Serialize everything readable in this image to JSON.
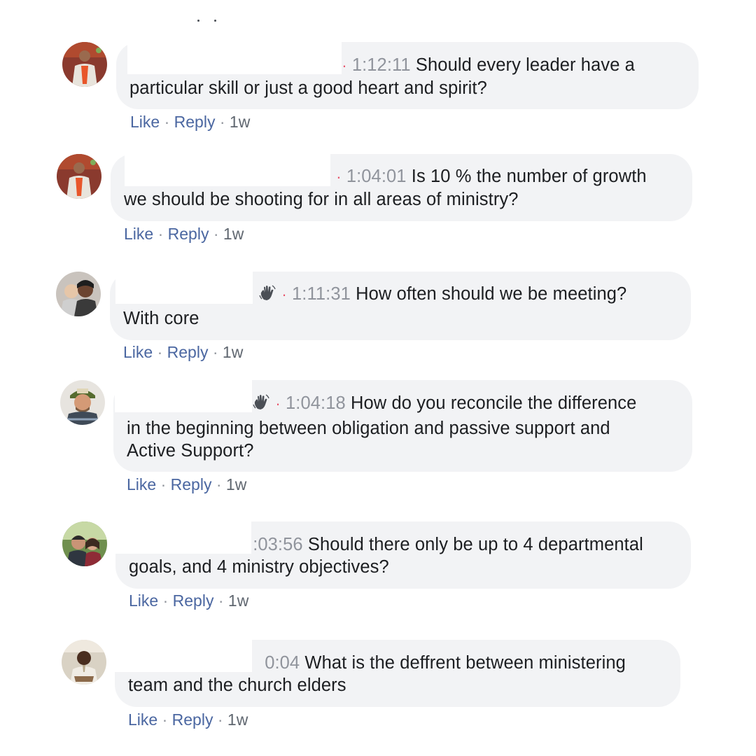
{
  "comments": [
    {
      "timestamp": "1:12:11",
      "lines": [
        "Should every leader have a",
        "particular skill or just a good heart and spirit?"
      ],
      "like_label": "Like",
      "reply_label": "Reply",
      "age": "1w",
      "has_wave": false,
      "avatar_colors": {
        "bg": "#8a3a2e",
        "shirt": "#e8e4dc",
        "accent": "#e8562a",
        "skin": "#9a6a4e"
      }
    },
    {
      "timestamp": "1:04:01",
      "lines": [
        "Is 10 % the number of growth",
        "we should be shooting for in all areas of ministry?"
      ],
      "like_label": "Like",
      "reply_label": "Reply",
      "age": "1w",
      "has_wave": false,
      "avatar_colors": {
        "bg": "#8a3a2e",
        "shirt": "#e8e4dc",
        "accent": "#e8562a",
        "skin": "#9a6a4e"
      }
    },
    {
      "timestamp": "1:11:31",
      "lines": [
        "How often should we be meeting?",
        "With core"
      ],
      "like_label": "Like",
      "reply_label": "Reply",
      "age": "1w",
      "has_wave": true,
      "avatar_colors": {
        "bg": "#c9c3bd",
        "shirt": "#3a3a3a",
        "accent": "#2c2c2c",
        "skin": "#6b4430"
      }
    },
    {
      "timestamp": "1:04:18",
      "lines": [
        "How do you reconcile the difference",
        "in the beginning between obligation and passive support and",
        "Active Support?"
      ],
      "like_label": "Like",
      "reply_label": "Reply",
      "age": "1w",
      "has_wave": true,
      "avatar_colors": {
        "bg": "#e7e4df",
        "shirt": "#3f4a57",
        "accent": "#556b2f",
        "skin": "#d49a76"
      }
    },
    {
      "timestamp": ":03:56",
      "lines": [
        "Should there only be up to 4 departmental",
        "goals, and 4 ministry objectives?"
      ],
      "like_label": "Like",
      "reply_label": "Reply",
      "age": "1w",
      "has_wave": false,
      "avatar_colors": {
        "bg": "#6f8f4e",
        "shirt": "#2f3640",
        "accent": "#c7d9a5",
        "skin": "#c99476"
      }
    },
    {
      "timestamp": "0:04",
      "lines": [
        "What is the deffrent between ministering",
        "team and the church elders"
      ],
      "like_label": "Like",
      "reply_label": "Reply",
      "age": "1w",
      "has_wave": false,
      "avatar_colors": {
        "bg": "#d9d2c4",
        "shirt": "#f0ece4",
        "accent": "#8c6a4a",
        "skin": "#4a2e1f"
      }
    }
  ],
  "colors": {
    "bubble": "#f2f3f5",
    "link": "#4b67a1",
    "timestamp": "#90949c",
    "separator_dot": "#e9546b",
    "text": "#1c1e21"
  },
  "icons": {
    "wave": "waving-hand-icon"
  }
}
